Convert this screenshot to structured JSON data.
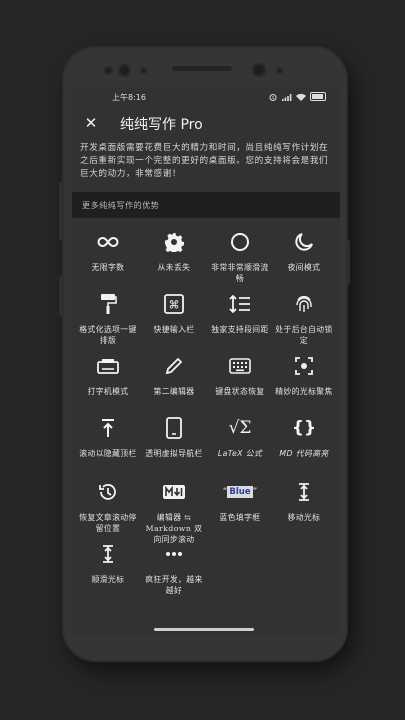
{
  "status": {
    "time": "上午8:16"
  },
  "app": {
    "title": "纯纯写作 Pro"
  },
  "description": "开发桌面版需要花费巨大的精力和时间，尚且纯纯写作计划在之后重新实现一个完整的更好的桌面版。您的支持将会是我们巨大的动力，非常感谢！",
  "more_label": "更多纯纯写作的优势",
  "features": [
    {
      "icon": "infinity-icon",
      "label": "无限字数"
    },
    {
      "icon": "gear-icon",
      "label": "从未丢失"
    },
    {
      "icon": "circle-icon",
      "label": "非常非常顺滑流畅"
    },
    {
      "icon": "moon-icon",
      "label": "夜间模式"
    },
    {
      "icon": "paint-roller-icon",
      "label": "格式化选项一键排版"
    },
    {
      "icon": "command-key-icon",
      "label": "快捷输入栏"
    },
    {
      "icon": "line-spacing-icon",
      "label": "独家支持段间距"
    },
    {
      "icon": "fingerprint-icon",
      "label": "处于后台自动锁定"
    },
    {
      "icon": "typewriter-icon",
      "label": "打字机模式"
    },
    {
      "icon": "pencil-icon",
      "label": "第二编辑器"
    },
    {
      "icon": "keyboard-icon",
      "label": "键盘状态恢复"
    },
    {
      "icon": "focus-icon",
      "label": "精妙的光标聚焦"
    },
    {
      "icon": "scroll-top-icon",
      "label": "滚动以隐藏顶栏"
    },
    {
      "icon": "tablet-icon",
      "label": "透明虚拟导航栏"
    },
    {
      "icon": "sqrt-icon",
      "icon_text": "√Σ",
      "label": "LaTeX 公式"
    },
    {
      "icon": "braces-icon",
      "icon_text": "{}",
      "label": "MD 代码高亮"
    },
    {
      "icon": "history-icon",
      "label": "恢复文章滚动停留位置"
    },
    {
      "icon": "markdown-icon",
      "label": "编辑器 ⇆ Markdown 双向同步滚动"
    },
    {
      "icon": "highlight-icon",
      "icon_text": "Blue",
      "label": "蓝色填字框"
    },
    {
      "icon": "text-cursor-icon",
      "label": "移动光标"
    },
    {
      "icon": "text-cursor-icon",
      "label": "顺滑光标"
    },
    {
      "icon": "more-icon",
      "label": "疯狂开发，越来越好"
    }
  ]
}
